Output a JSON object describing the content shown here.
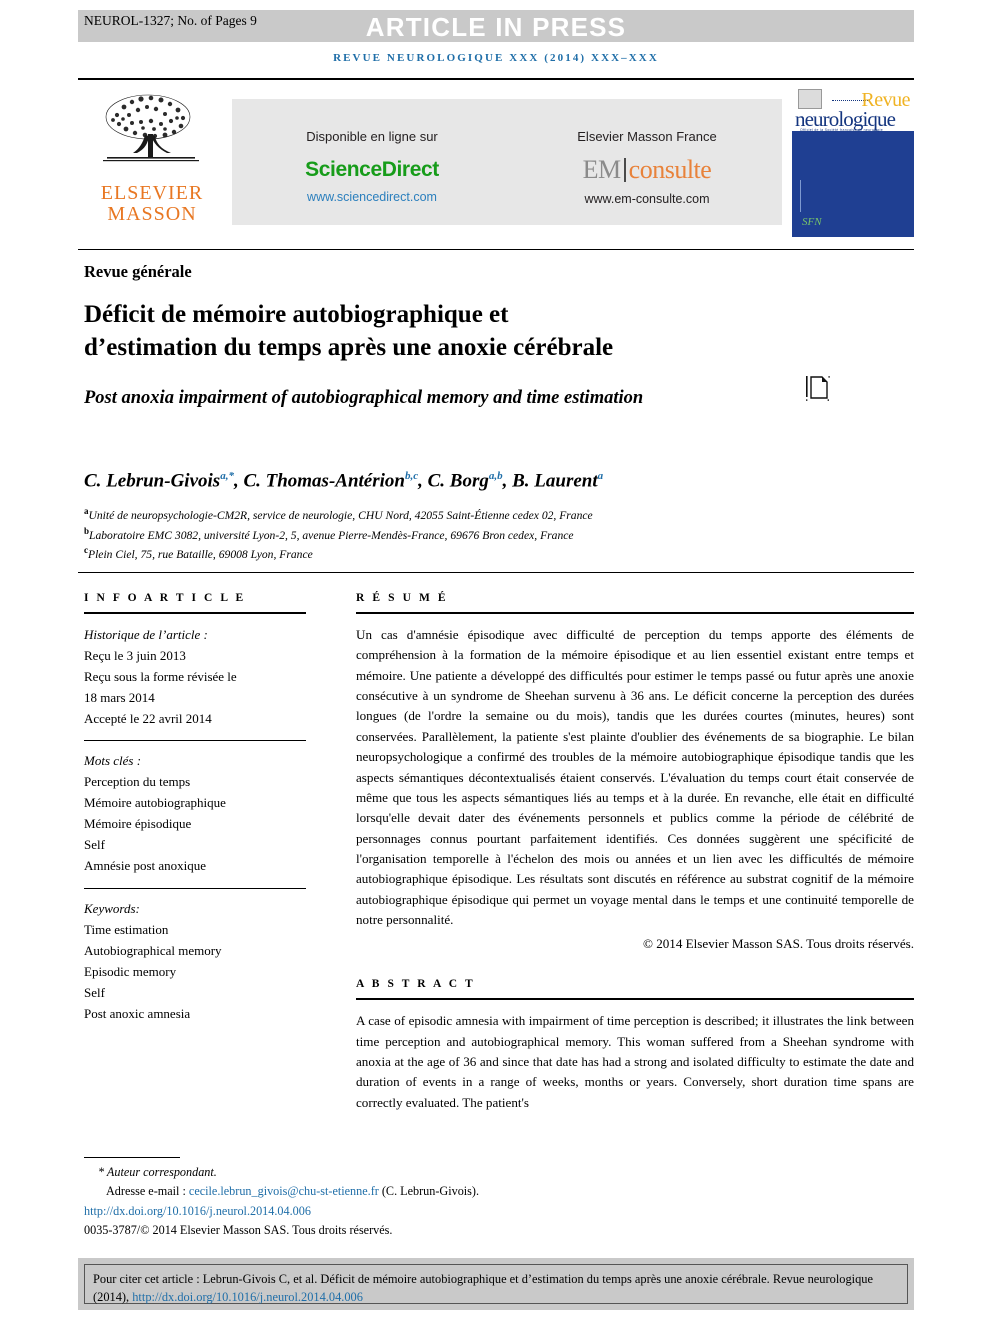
{
  "header": {
    "stamp": "NEUROL-1327; No. of Pages 9",
    "article_in_press": "ARTICLE IN PRESS",
    "running_head": "REVUE NEUROLOGIQUE XXX (2014) XXX–XXX"
  },
  "banner": {
    "publisher_name_line1": "ELSEVIER",
    "publisher_name_line2": "MASSON",
    "sciencedirect": {
      "caption": "Disponible en ligne sur",
      "brand_part1": "Science",
      "brand_part2": "Direct",
      "url": "www.sciencedirect.com"
    },
    "emconsulte": {
      "caption": "Elsevier Masson France",
      "brand_part1": "EM",
      "brand_part2": "consulte",
      "url": "www.em-consulte.com"
    },
    "journal_cover": {
      "title_line1": "Revue",
      "title_line2": "neurologique",
      "subtitle": "Officiel de la Société française de neurologie",
      "society_mark": "SFN"
    }
  },
  "article": {
    "section_kind": "Revue générale",
    "title_fr_line1": "Déficit de mémoire autobiographique et",
    "title_fr_line2": "d’estimation du temps après une anoxie cérébrale",
    "title_en": "Post anoxia impairment of autobiographical memory and time estimation",
    "crossmark_label": "CrossMark"
  },
  "authors": {
    "list": "C. Lebrun-Givois a,*, C. Thomas-Antérion b,c, C. Borg a,b, B. Laurent a",
    "affiliations": [
      {
        "label": "a",
        "text": "Unité de neuropsychologie-CM2R, service de neurologie, CHU Nord, 42055 Saint-Étienne cedex 02, France"
      },
      {
        "label": "b",
        "text": "Laboratoire EMC 3082, université Lyon-2, 5, avenue Pierre-Mendès-France, 69676 Bron cedex, France"
      },
      {
        "label": "c",
        "text": "Plein Ciel, 75, rue Bataille, 69008 Lyon, France"
      }
    ]
  },
  "info_article": {
    "heading": "I N F O   A R T I C L E",
    "history_title": "Historique de l’article :",
    "history_lines": [
      "Reçu le 3 juin 2013",
      "Reçu sous la forme révisée le",
      "18 mars 2014",
      "Accepté le 22 avril 2014"
    ],
    "motscles_title": "Mots clés :",
    "motscles": [
      "Perception du temps",
      "Mémoire autobiographique",
      "Mémoire épisodique",
      "Self",
      "Amnésie post anoxique"
    ],
    "keywords_title": "Keywords:",
    "keywords": [
      "Time estimation",
      "Autobiographical memory",
      "Episodic memory",
      "Self",
      "Post anoxic amnesia"
    ]
  },
  "resume": {
    "heading": "R É S U M É",
    "body": "Un cas d'amnésie épisodique avec difficulté de perception du temps apporte des éléments de compréhension à la formation de la mémoire épisodique et au lien essentiel existant entre temps et mémoire. Une patiente a développé des difficultés pour estimer le temps passé ou futur après une anoxie consécutive à un syndrome de Sheehan survenu à 36 ans. Le déficit concerne la perception des durées longues (de l'ordre la semaine ou du mois), tandis que les durées courtes (minutes, heures) sont conservées. Parallèlement, la patiente s'est plainte d'oublier des événements de sa biographie. Le bilan neuropsychologique a confirmé des troubles de la mémoire autobiographique épisodique tandis que les aspects sémantiques décontextualisés étaient conservés. L'évaluation du temps court était conservée de même que tous les aspects sémantiques liés au temps et à la durée. En revanche, elle était en difficulté lorsqu'elle devait dater des événements personnels et publics comme la période de célébrité de personnages connus pourtant parfaitement identifiés. Ces données suggèrent une spécificité de l'organisation temporelle à l'échelon des mois ou années et un lien avec les difficultés de mémoire autobiographique épisodique. Les résultats sont discutés en référence au substrat cognitif de la mémoire autobiographique épisodique qui permet un voyage mental dans le temps et une continuité temporelle de notre personnalité.",
    "copyright": "© 2014 Elsevier Masson SAS. Tous droits réservés."
  },
  "abstract": {
    "heading": "A B S T R A C T",
    "body": "A case of episodic amnesia with impairment of time perception is described; it illustrates the link between time perception and autobiographical memory. This woman suffered from a Sheehan syndrome with anoxia at the age of 36 and since that date has had a strong and isolated difficulty to estimate the date and duration of events in a range of weeks, months or years. Conversely, short duration time spans are correctly evaluated. The patient's"
  },
  "footnote": {
    "corresponding": "* Auteur correspondant.",
    "email_label": "Adresse e-mail :",
    "email": "cecile.lebrun_givois@chu-st-etienne.fr",
    "email_owner": "(C. Lebrun-Givois).",
    "doi": "http://dx.doi.org/10.1016/j.neurol.2014.04.006",
    "issn_line": "0035-3787/© 2014 Elsevier Masson SAS. Tous droits réservés."
  },
  "citation_box": {
    "text_before": "Pour citer cet article : Lebrun-Givois C, et al. Déficit de mémoire autobiographique et d’estimation du temps après une anoxie cérébrale. Revue neurologique (2014), ",
    "link": "http://dx.doi.org/10.1016/j.neurol.2014.04.006"
  },
  "colors": {
    "band_gray": "#c9c9c9",
    "journal_blue": "#1f6ea8",
    "elsevier_orange": "#e87722",
    "sciencedirect_green": "#179c1a",
    "link_blue": "#2b7fbd",
    "cover_blue": "#1f3f92",
    "cover_gold": "#f0b323"
  }
}
